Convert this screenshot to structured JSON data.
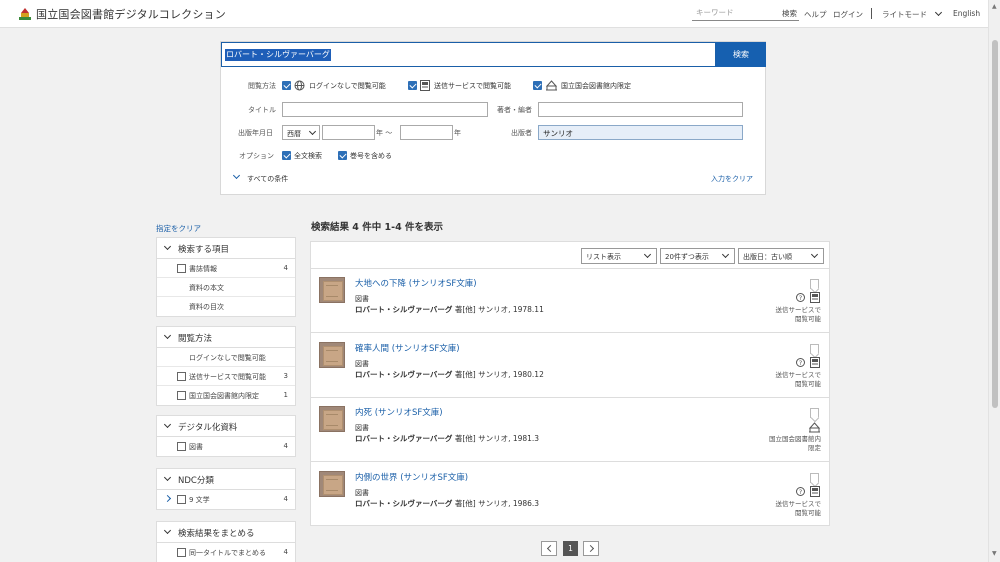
{
  "header": {
    "logo_text": "国立国会図書館デジタルコレクション",
    "search_placeholder": "キーワード",
    "search_button": "検索",
    "help": "ヘルプ",
    "login": "ログイン",
    "light_mode": "ライトモード",
    "english": "English"
  },
  "search": {
    "query": "ロバート・シルヴァーバーグ",
    "button": "検索",
    "access_label": "閲覧方法",
    "access_options": [
      "ログインなしで閲覧可能",
      "送信サービスで閲覧可能",
      "国立国会図書館内限定"
    ],
    "title_label": "タイトル",
    "title_value": "",
    "author_label": "著者・編者",
    "author_value": "",
    "date_label": "出版年月日",
    "era": "西暦",
    "year_from": "",
    "year_unit1": "年 〜",
    "year_to": "",
    "year_unit2": "年",
    "publisher_label": "出版者",
    "publisher_value": "サンリオ",
    "options_label": "オプション",
    "option1": "全文検索",
    "option2": "巻号を含める",
    "all_conditions": "すべての条件",
    "clear_input": "入力をクリア"
  },
  "filters": {
    "clear": "指定をクリア",
    "groups": [
      {
        "title": "検索する項目",
        "rows": [
          {
            "label": "書誌情報",
            "count": "4",
            "checkbox": true
          },
          {
            "label": "資料の本文",
            "count": "",
            "checkbox": false
          },
          {
            "label": "資料の目次",
            "count": "",
            "checkbox": false
          }
        ]
      },
      {
        "title": "閲覧方法",
        "rows": [
          {
            "label": "ログインなしで閲覧可能",
            "count": "",
            "checkbox": false
          },
          {
            "label": "送信サービスで閲覧可能",
            "count": "3",
            "checkbox": true
          },
          {
            "label": "国立国会図書館内限定",
            "count": "1",
            "checkbox": true
          }
        ]
      },
      {
        "title": "デジタル化資料",
        "rows": [
          {
            "label": "図書",
            "count": "4",
            "checkbox": true
          }
        ]
      },
      {
        "title": "NDC分類",
        "rows": [
          {
            "label": "9 文学",
            "count": "4",
            "checkbox": true
          }
        ]
      },
      {
        "title": "検索結果をまとめる",
        "rows": [
          {
            "label": "同一タイトルでまとめる",
            "count": "4",
            "checkbox": true
          }
        ]
      }
    ]
  },
  "results": {
    "summary": "検索結果 4 件中 1-4 件を表示",
    "view_select": "リスト表示",
    "per_page_select": "20件ずつ表示",
    "sort_select": "出版日：古い順",
    "items": [
      {
        "title": "大地への下降 (サンリオSF文庫)",
        "type": "図書",
        "author": "ロバート・シルヴァーバーグ",
        "meta": "著[他] サンリオ, 1978.11",
        "availability": [
          "送信サービスで",
          "閲覧可能"
        ]
      },
      {
        "title": "確率人間 (サンリオSF文庫)",
        "type": "図書",
        "author": "ロバート・シルヴァーバーグ",
        "meta": "著[他] サンリオ, 1980.12",
        "availability": [
          "送信サービスで",
          "閲覧可能"
        ]
      },
      {
        "title": "内死 (サンリオSF文庫)",
        "type": "図書",
        "author": "ロバート・シルヴァーバーグ",
        "meta": "著[他] サンリオ, 1981.3",
        "availability": [
          "国立国会図書館内",
          "限定"
        ]
      },
      {
        "title": "内側の世界 (サンリオSF文庫)",
        "type": "図書",
        "author": "ロバート・シルヴァーバーグ",
        "meta": "著[他] サンリオ, 1986.3",
        "availability": [
          "送信サービスで",
          "閲覧可能"
        ]
      }
    ]
  },
  "pagination": {
    "current": "1"
  }
}
